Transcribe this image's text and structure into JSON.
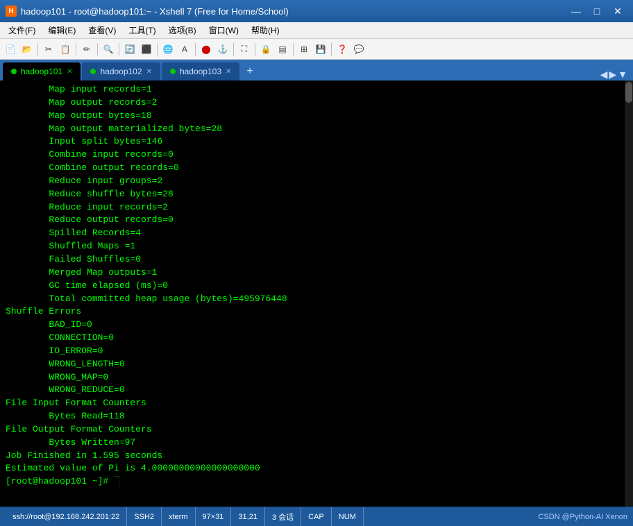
{
  "titleBar": {
    "icon": "H",
    "title": "hadoop101 - root@hadoop101:~ - Xshell 7 (Free for Home/School)",
    "minimize": "—",
    "maximize": "□",
    "close": "✕"
  },
  "menuBar": {
    "items": [
      "文件(F)",
      "编辑(E)",
      "查看(V)",
      "工具(T)",
      "选项(B)",
      "窗口(W)",
      "帮助(H)"
    ]
  },
  "tabs": [
    {
      "label": "hadoop101",
      "active": true
    },
    {
      "label": "hadoop102",
      "active": false
    },
    {
      "label": "hadoop103",
      "active": false
    }
  ],
  "terminal": {
    "lines": [
      "        Map input records=1",
      "        Map output records=2",
      "        Map output bytes=18",
      "        Map output materialized bytes=28",
      "        Input split bytes=146",
      "        Combine input records=0",
      "        Combine output records=0",
      "        Reduce input groups=2",
      "        Reduce shuffle bytes=28",
      "        Reduce input records=2",
      "        Reduce output records=0",
      "        Spilled Records=4",
      "        Shuffled Maps =1",
      "        Failed Shuffles=0",
      "        Merged Map outputs=1",
      "        GC time elapsed (ms)=0",
      "        Total committed heap usage (bytes)=495976448",
      "Shuffle Errors",
      "        BAD_ID=0",
      "        CONNECTION=0",
      "        IO_ERROR=0",
      "        WRONG_LENGTH=0",
      "        WRONG_MAP=0",
      "        WRONG_REDUCE=0",
      "File Input Format Counters",
      "        Bytes Read=118",
      "File Output Format Counters",
      "        Bytes Written=97",
      "Job Finished in 1.595 seconds",
      "Estimated value of Pi is 4.00000000000000000000",
      "[root@hadoop101 ~]# "
    ]
  },
  "statusBar": {
    "connection": "ssh://root@192.168.242.201:22",
    "protocol": "SSH2",
    "terminal": "xterm",
    "size": "97×31",
    "position": "31,21",
    "sessions": "3 会话",
    "caps": "CAP",
    "num": "NUM",
    "brand": "CSDN @Python-AI Xenon"
  }
}
